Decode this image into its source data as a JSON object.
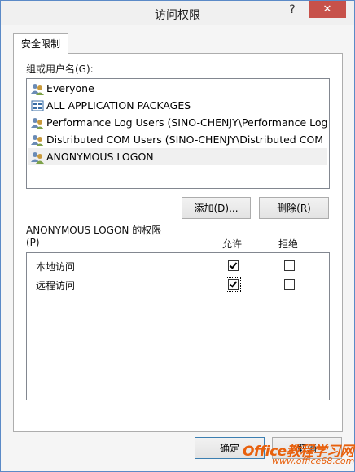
{
  "window": {
    "title": "访问权限",
    "help": "?",
    "close": "✕"
  },
  "tabs": [
    "安全限制"
  ],
  "groups": {
    "label": "组或用户名(G):",
    "items": [
      {
        "name": "Everyone",
        "icon": "users-icon"
      },
      {
        "name": "ALL APPLICATION PACKAGES",
        "icon": "packages-icon"
      },
      {
        "name": "Performance Log Users (SINO-CHENJY\\Performance Log ...",
        "icon": "users-icon"
      },
      {
        "name": "Distributed COM Users (SINO-CHENJY\\Distributed COM ...",
        "icon": "users-icon"
      },
      {
        "name": "ANONYMOUS LOGON",
        "icon": "users-icon",
        "selected": true
      }
    ]
  },
  "buttons": {
    "add": "添加(D)...",
    "remove": "删除(R)",
    "ok": "确定",
    "cancel": "取消"
  },
  "permissions": {
    "label_line1": "ANONYMOUS LOGON 的权限",
    "label_line2": "(P)",
    "allow_header": "允许",
    "deny_header": "拒绝",
    "rows": [
      {
        "name": "本地访问",
        "allow": true,
        "deny": false
      },
      {
        "name": "远程访问",
        "allow": true,
        "deny": false
      }
    ]
  },
  "watermark": {
    "line1": "Office教程学习网",
    "line2": "www.office68.com"
  }
}
